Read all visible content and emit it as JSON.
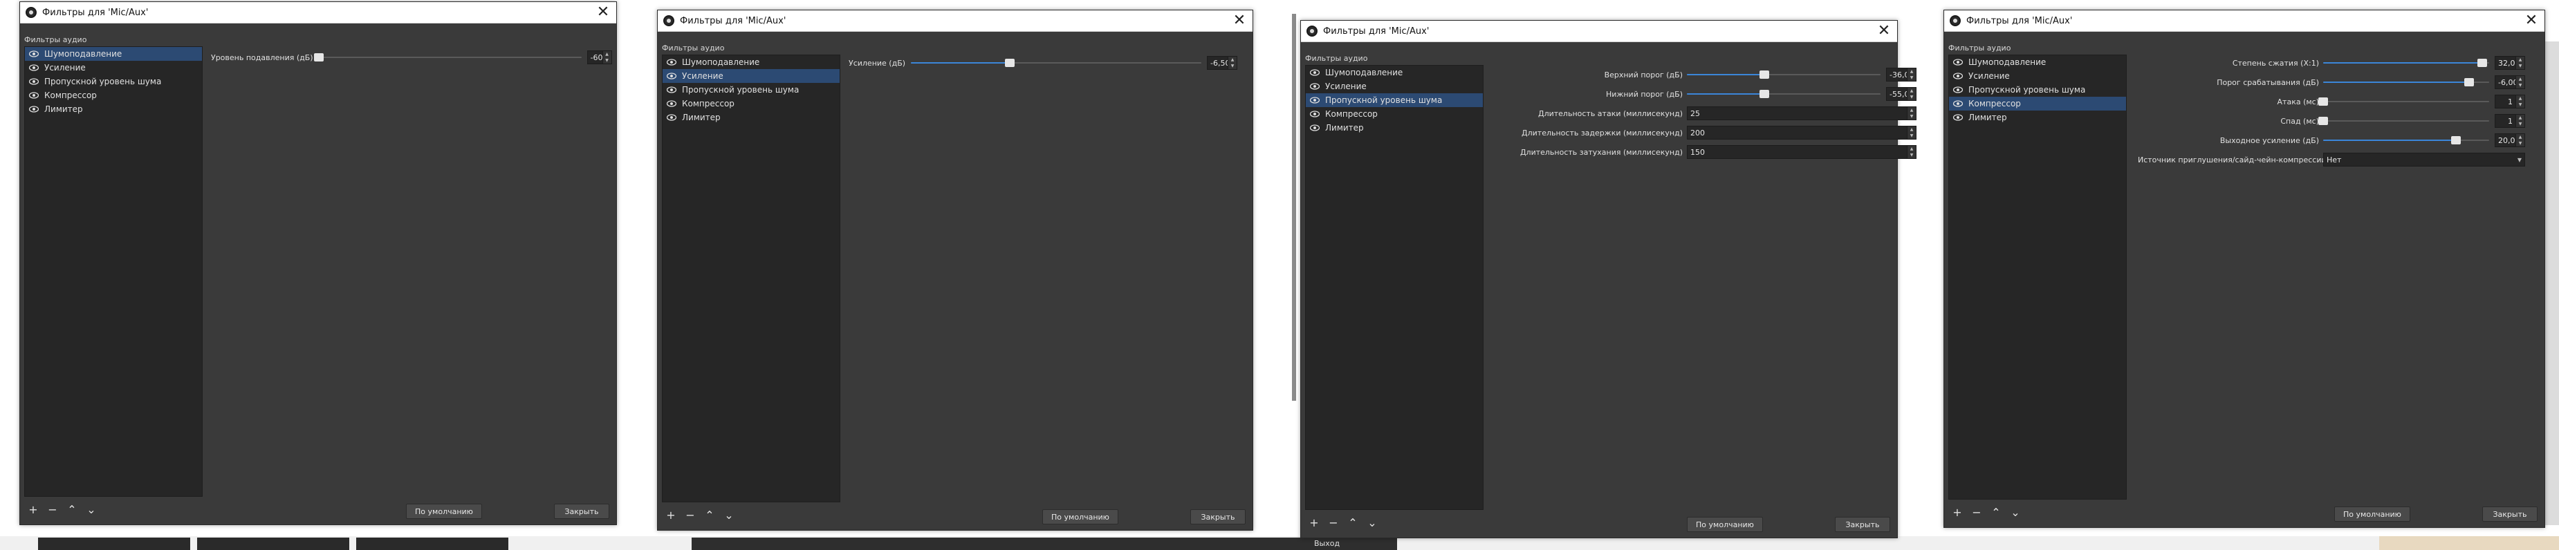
{
  "colors": {
    "accent": "#3b86d9",
    "selection": "#2c4a73",
    "panel": "#3a3a3a",
    "list_bg": "#262626"
  },
  "dialogs": [
    {
      "title": "Фильтры для 'Mic/Aux'",
      "section": "Фильтры аудио",
      "filters": [
        "Шумоподавление",
        "Усиление",
        "Пропускной уровень шума",
        "Компрессор",
        "Лимитер"
      ],
      "selected": 0,
      "toolbar_icons": [
        "plus-icon",
        "minus-icon",
        "arrow-up-icon",
        "arrow-down-icon"
      ],
      "defaults_button": "По умолчанию",
      "close_button": "Закрыть",
      "properties": [
        {
          "label": "Уровень подавления (дБ)",
          "type": "slider",
          "value": "-60",
          "fraction": 0.0
        }
      ]
    },
    {
      "title": "Фильтры для 'Mic/Aux'",
      "section": "Фильтры аудио",
      "filters": [
        "Шумоподавление",
        "Усиление",
        "Пропускной уровень шума",
        "Компрессор",
        "Лимитер"
      ],
      "selected": 1,
      "toolbar_icons": [
        "plus-icon",
        "minus-icon",
        "arrow-up-icon",
        "arrow-down-icon"
      ],
      "defaults_button": "По умолчанию",
      "close_button": "Закрыть",
      "properties": [
        {
          "label": "Усиление (дБ)",
          "type": "slider",
          "value": "-6,50",
          "fraction": 0.34
        }
      ]
    },
    {
      "title": "Фильтры для 'Mic/Aux'",
      "section": "Фильтры аудио",
      "filters": [
        "Шумоподавление",
        "Усиление",
        "Пропускной уровень шума",
        "Компрессор",
        "Лимитер"
      ],
      "selected": 2,
      "toolbar_icons": [
        "plus-icon",
        "minus-icon",
        "arrow-up-icon",
        "arrow-down-icon"
      ],
      "defaults_button": "По умолчанию",
      "close_button": "Закрыть",
      "properties": [
        {
          "label": "Верхний порог (дБ)",
          "type": "slider",
          "value": "-36,00",
          "fraction": 0.4
        },
        {
          "label": "Нижний порог (дБ)",
          "type": "slider",
          "value": "-55,00",
          "fraction": 0.4
        },
        {
          "label": "Длительность атаки (миллисекунд)",
          "type": "spin",
          "value": "25"
        },
        {
          "label": "Длительность задержки (миллисекунд)",
          "type": "spin",
          "value": "200"
        },
        {
          "label": "Длительность затухания (миллисекунд)",
          "type": "spin",
          "value": "150"
        }
      ]
    },
    {
      "title": "Фильтры для 'Mic/Aux'",
      "section": "Фильтры аудио",
      "filters": [
        "Шумоподавление",
        "Усиление",
        "Пропускной уровень шума",
        "Компрессор",
        "Лимитер"
      ],
      "selected": 3,
      "toolbar_icons": [
        "plus-icon",
        "minus-icon",
        "arrow-up-icon",
        "arrow-down-icon"
      ],
      "defaults_button": "По умолчанию",
      "close_button": "Закрыть",
      "properties": [
        {
          "label": "Степень сжатия (X:1)",
          "type": "slider",
          "value": "32,00",
          "fraction": 0.96
        },
        {
          "label": "Порог срабатывания (дБ)",
          "type": "slider",
          "value": "-6,00",
          "fraction": 0.88
        },
        {
          "label": "Атака (мс)",
          "type": "slider",
          "value": "1",
          "fraction": 0.0
        },
        {
          "label": "Спад (мс)",
          "type": "slider",
          "value": "1",
          "fraction": 0.0
        },
        {
          "label": "Выходное усиление (дБ)",
          "type": "slider",
          "value": "20,00",
          "fraction": 0.8
        },
        {
          "label": "Источник приглушения/сайд-чейн-компрессии",
          "type": "combo",
          "value": "Нет"
        }
      ]
    }
  ],
  "taskbar": {
    "exit_label": "Выход"
  }
}
